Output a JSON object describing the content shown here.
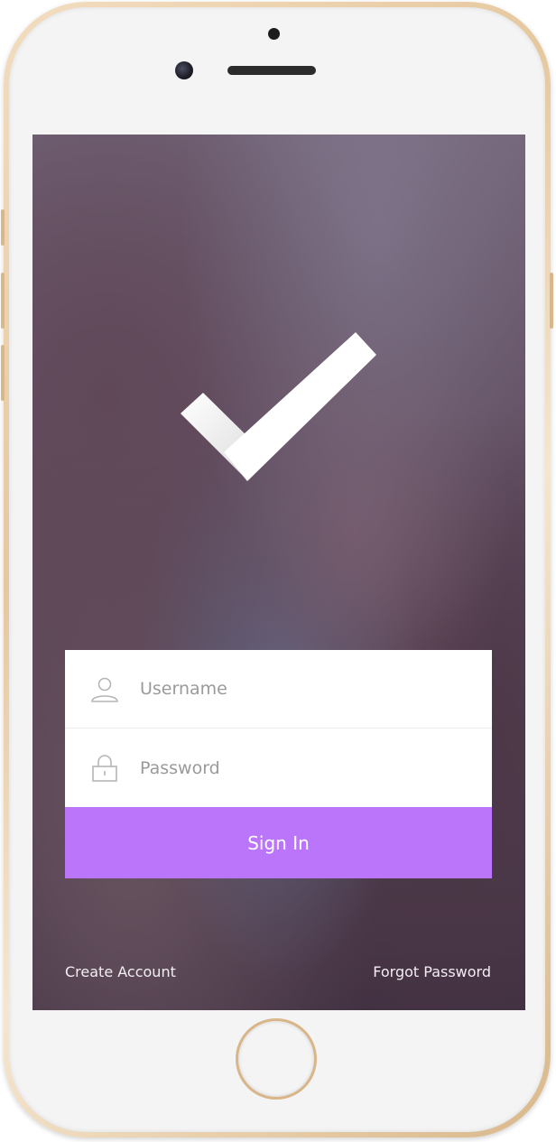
{
  "login": {
    "username_placeholder": "Username",
    "password_placeholder": "Password",
    "signin_label": "Sign In"
  },
  "footer": {
    "create_account_label": "Create Account",
    "forgot_password_label": "Forgot Password"
  },
  "icons": {
    "logo": "checkmark-icon",
    "username": "user-icon",
    "password": "lock-icon"
  },
  "colors": {
    "accent": "#bb75fb",
    "phone_frame": "#e6c89e"
  }
}
